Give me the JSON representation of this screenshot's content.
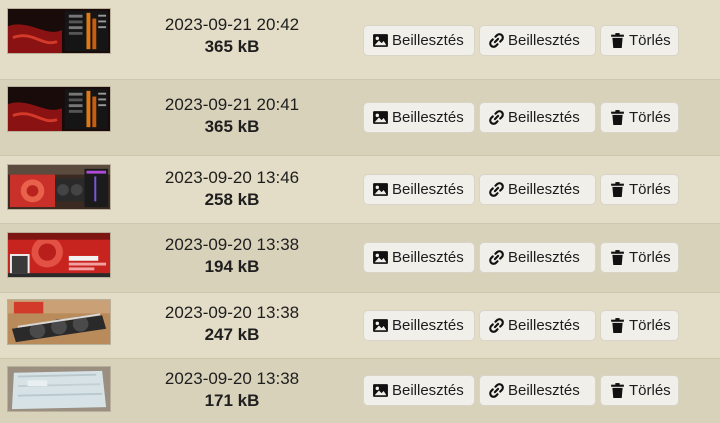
{
  "buttons": {
    "insert_image_label": "Beillesztés",
    "insert_link_label": "Beillesztés",
    "delete_label": "Törlés"
  },
  "icons": {
    "insert_image": "image-icon",
    "insert_link": "link-icon",
    "delete": "trash-icon"
  },
  "files": [
    {
      "date": "2023-09-21 20:42",
      "size": "365 kB",
      "thumbnail": "dark-red-monitor-screenshot"
    },
    {
      "date": "2023-09-21 20:41",
      "size": "365 kB",
      "thumbnail": "dark-red-monitor-screenshot"
    },
    {
      "date": "2023-09-20 13:46",
      "size": "258 kB",
      "thumbnail": "graphics-card-box-photo"
    },
    {
      "date": "2023-09-20 13:38",
      "size": "194 kB",
      "thumbnail": "red-amd-box-photo"
    },
    {
      "date": "2023-09-20 13:38",
      "size": "247 kB",
      "thumbnail": "graphics-card-fans-photo"
    },
    {
      "date": "2023-09-20 13:38",
      "size": "171 kB",
      "thumbnail": "white-package-photo"
    }
  ]
}
